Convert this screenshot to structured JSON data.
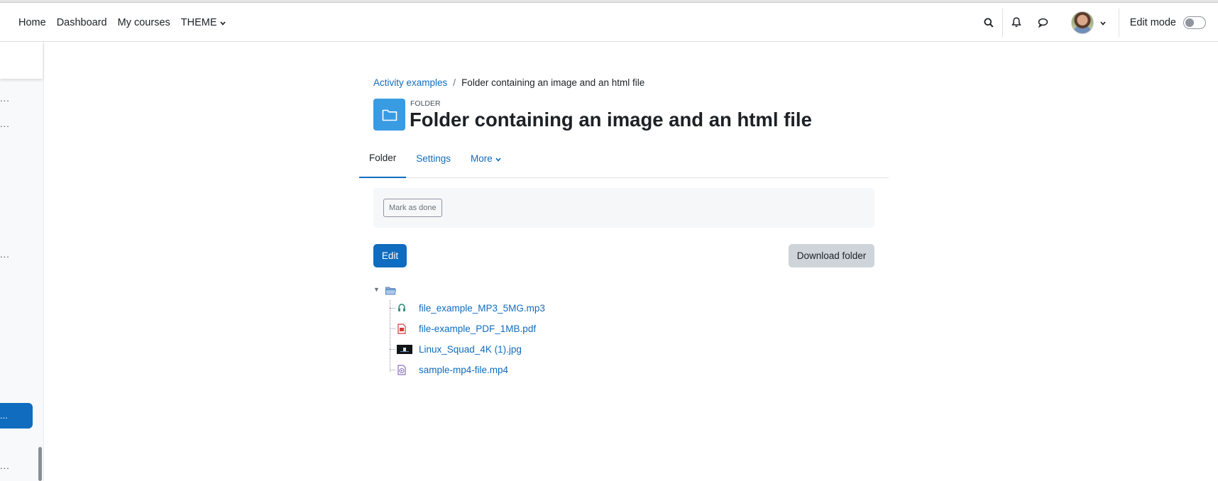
{
  "navbar": {
    "links": [
      "Home",
      "Dashboard",
      "My courses",
      "THEME"
    ],
    "edit_mode_label": "Edit mode",
    "edit_mode_on": false,
    "icons": [
      "search-icon",
      "bell-icon",
      "chat-icon",
      "chevron-down-icon"
    ]
  },
  "breadcrumb": {
    "parent": "Activity examples",
    "separator": "/",
    "current": "Folder containing an image and an html file"
  },
  "header": {
    "pretitle": "FOLDER",
    "title": "Folder containing an image and an html file",
    "icon": "folder-icon",
    "accent_color": "#399be2"
  },
  "tabs": [
    {
      "label": "Folder",
      "active": true
    },
    {
      "label": "Settings",
      "active": false
    },
    {
      "label": "More",
      "active": false
    }
  ],
  "completion": {
    "mark_done_label": "Mark as done"
  },
  "actions": {
    "edit_label": "Edit",
    "download_label": "Download folder"
  },
  "files": [
    {
      "name": "file_example_MP3_5MG.mp3",
      "icon": "audio-file-icon"
    },
    {
      "name": "file-example_PDF_1MB.pdf",
      "icon": "pdf-file-icon"
    },
    {
      "name": "Linux_Squad_4K (1).jpg",
      "icon": "image-thumbnail-icon"
    },
    {
      "name": "sample-mp4-file.mp4",
      "icon": "video-file-icon"
    }
  ],
  "drawer": {
    "truncated_label": "..."
  },
  "colors": {
    "primary": "#0f6cbf",
    "secondary_button": "#ced4da"
  }
}
